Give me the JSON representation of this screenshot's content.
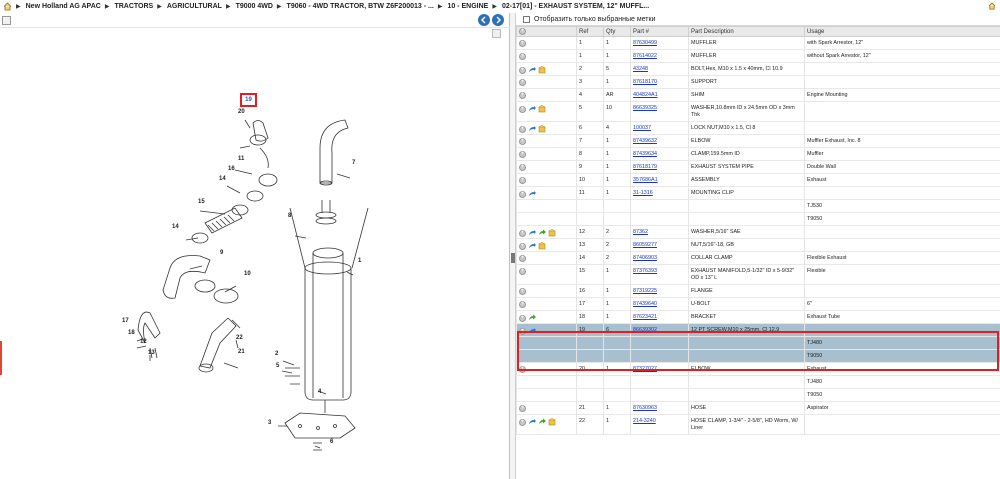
{
  "breadcrumb": [
    "New Holland AG APAC",
    "TRACTORS",
    "AGRICULTURAL",
    "T9000 4WD",
    "T9060 - 4WD TRACTOR, BTW Z6F200013 - ...",
    "10 - ENGINE",
    "02-17[01] - EXHAUST SYSTEM, 12\" MUFFL..."
  ],
  "filter": {
    "label": "Отобразить только выбранные метки"
  },
  "table": {
    "headers": [
      "",
      "Ref",
      "Qty",
      "Part #",
      "Part Description",
      "Usage"
    ],
    "rows": [
      {
        "icons": [],
        "ref": "1",
        "qty": "1",
        "part": "87630499",
        "desc": "MUFFLER",
        "usage": "with Spark Arrestor, 12\""
      },
      {
        "icons": [],
        "ref": "1",
        "qty": "1",
        "part": "87614022",
        "desc": "MUFFLER",
        "usage": "without Spark Arrestor, 12\""
      },
      {
        "icons": [
          "share",
          "box"
        ],
        "ref": "2",
        "qty": "5",
        "part": "43248",
        "desc": "BOLT,Hex, M10 x 1.5 x 40mm, Cl 10.9",
        "usage": ""
      },
      {
        "icons": [],
        "ref": "3",
        "qty": "1",
        "part": "87618170",
        "desc": "SUPPORT",
        "usage": ""
      },
      {
        "icons": [],
        "ref": "4",
        "qty": "AR",
        "part": "404824A1",
        "desc": "SHIM",
        "usage": "Engine Mounting"
      },
      {
        "icons": [
          "share",
          "box"
        ],
        "ref": "5",
        "qty": "10",
        "part": "86639325",
        "desc": "WASHER,10.8mm ID x 24.5mm OD x 3mm Thk",
        "usage": ""
      },
      {
        "icons": [
          "share",
          "box"
        ],
        "ref": "6",
        "qty": "4",
        "part": "100037",
        "desc": "LOCK NUT,M10 x 1.5, Cl 8",
        "usage": ""
      },
      {
        "icons": [],
        "ref": "7",
        "qty": "1",
        "part": "87439632",
        "desc": "ELBOW",
        "usage": "Muffler Exhaust, Inc. 8"
      },
      {
        "icons": [],
        "ref": "8",
        "qty": "1",
        "part": "87439634",
        "desc": "CLAMP,159.5mm ID",
        "usage": "Muffler"
      },
      {
        "icons": [],
        "ref": "9",
        "qty": "1",
        "part": "87618179",
        "desc": "EXHAUST SYSTEM PIPE",
        "usage": "Double Wall"
      },
      {
        "icons": [],
        "ref": "10",
        "qty": "1",
        "part": "357686A1",
        "desc": "ASSEMBLY",
        "usage": "Exhaust"
      },
      {
        "icons": [
          "share"
        ],
        "ref": "11",
        "qty": "1",
        "part": "31-1316",
        "desc": "MOUNTING CLIP",
        "usage": ""
      },
      {
        "icons": [],
        "ref": "",
        "qty": "",
        "part": "",
        "desc": "",
        "usage": "TJ530"
      },
      {
        "icons": [],
        "ref": "",
        "qty": "",
        "part": "",
        "desc": "",
        "usage": "T9050"
      },
      {
        "icons": [
          "share",
          "go",
          "box"
        ],
        "ref": "12",
        "qty": "2",
        "part": "87362",
        "desc": "WASHER,5/16\" SAE",
        "usage": ""
      },
      {
        "icons": [
          "share",
          "box"
        ],
        "ref": "13",
        "qty": "2",
        "part": "86059277",
        "desc": "NUT,5/16\"-18, GB",
        "usage": ""
      },
      {
        "icons": [],
        "ref": "14",
        "qty": "2",
        "part": "87406903",
        "desc": "COLLAR CLAMP",
        "usage": "Flexible Exhaust"
      },
      {
        "icons": [],
        "ref": "15",
        "qty": "1",
        "part": "87376393",
        "desc": "EXHAUST MANIFOLD,5-1/32\" ID x 5-9/32\" OD x 13\" L",
        "usage": "Flexible"
      },
      {
        "icons": [],
        "ref": "16",
        "qty": "1",
        "part": "87319225",
        "desc": "FLANGE",
        "usage": ""
      },
      {
        "icons": [],
        "ref": "17",
        "qty": "1",
        "part": "87439640",
        "desc": "U-BOLT",
        "usage": "6\""
      },
      {
        "icons": [
          "go"
        ],
        "ref": "18",
        "qty": "1",
        "part": "87623421",
        "desc": "BRACKET",
        "usage": "Exhaust Tube"
      },
      {
        "icons": [
          "share"
        ],
        "ref": "19",
        "qty": "6",
        "part": "86639302",
        "desc": "12 PT SCREW,M10 x 25mm, Cl 12.9",
        "usage": "",
        "selected": true
      },
      {
        "icons": [],
        "ref": "",
        "qty": "",
        "part": "",
        "desc": "",
        "usage": "TJ480",
        "selected": true
      },
      {
        "icons": [],
        "ref": "",
        "qty": "",
        "part": "",
        "desc": "",
        "usage": "T9050",
        "selected": true
      },
      {
        "icons": [],
        "ref": "20",
        "qty": "1",
        "part": "87327027",
        "desc": "ELBOW",
        "usage": "Exhaust"
      },
      {
        "icons": [],
        "ref": "",
        "qty": "",
        "part": "",
        "desc": "",
        "usage": "TJ480"
      },
      {
        "icons": [],
        "ref": "",
        "qty": "",
        "part": "",
        "desc": "",
        "usage": "T9050"
      },
      {
        "icons": [],
        "ref": "21",
        "qty": "1",
        "part": "87630963",
        "desc": "HOSE",
        "usage": "Aspirator"
      },
      {
        "icons": [
          "share",
          "go",
          "box"
        ],
        "ref": "22",
        "qty": "1",
        "part": "214-3240",
        "desc": "HOSE CLAMP, 1-3/4\" - 2-5/8\", HD Worm, W/ Liner",
        "usage": ""
      }
    ]
  },
  "diagram": {
    "callouts": [
      "1",
      "2",
      "3",
      "4",
      "5",
      "6",
      "7",
      "8",
      "9",
      "10",
      "11",
      "12",
      "13",
      "14",
      "15",
      "16",
      "17",
      "18",
      "19",
      "20",
      "21",
      "22"
    ],
    "selected_callout": "19"
  },
  "colors": {
    "link": "#1a35c8",
    "selected_row": "#a8bfcf",
    "highlight": "#e02020",
    "nav": "#2f6fba"
  }
}
